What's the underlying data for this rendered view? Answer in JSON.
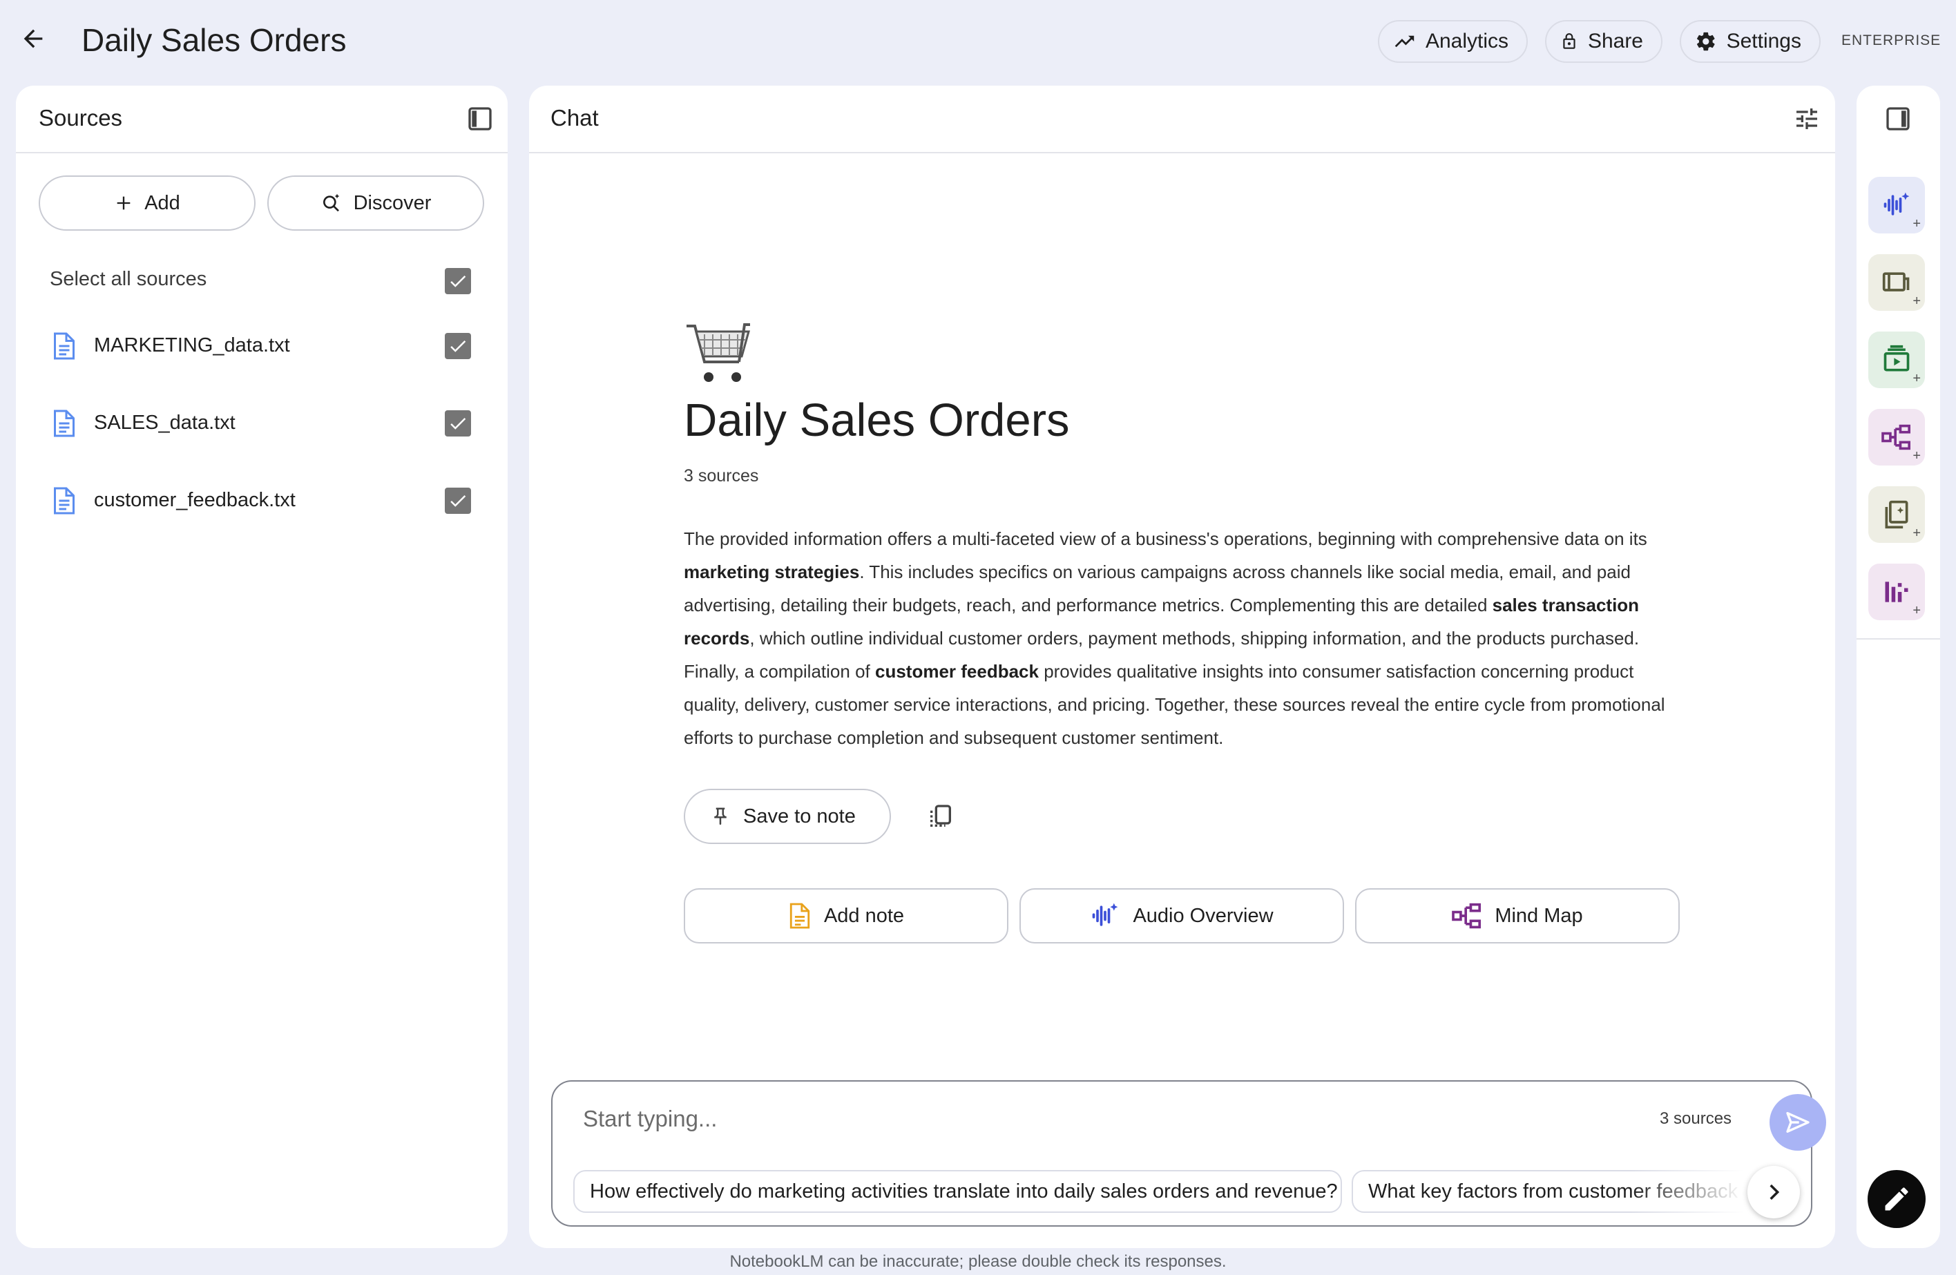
{
  "header": {
    "back_icon": "arrow-left-icon",
    "notebook_title": "Daily Sales Orders",
    "analytics_label": "Analytics",
    "share_label": "Share",
    "settings_label": "Settings",
    "badge": "ENTERPRISE"
  },
  "sources": {
    "title": "Sources",
    "add_label": "Add",
    "discover_label": "Discover",
    "select_all_label": "Select all sources",
    "items": [
      {
        "name": "MARKETING_data.txt",
        "checked": true
      },
      {
        "name": "SALES_data.txt",
        "checked": true
      },
      {
        "name": "customer_feedback.txt",
        "checked": true
      }
    ]
  },
  "chat": {
    "title": "Chat",
    "notebook_emoji": "shopping-cart",
    "notebook_title": "Daily Sales Orders",
    "source_count": "3 sources",
    "summary": {
      "p1": "The provided information offers a multi-faceted view of a business's operations, beginning with comprehensive data on its ",
      "b1": "marketing strategies",
      "p2": ". This includes specifics on various campaigns across channels like social media, email, and paid advertising, detailing their budgets, reach, and performance metrics. Complementing this are detailed ",
      "b2": "sales transaction records",
      "p3": ", which outline individual customer orders, payment methods, shipping information, and the products purchased. Finally, a compilation of ",
      "b3": "customer feedback",
      "p4": " provides qualitative insights into consumer satisfaction concerning product quality, delivery, customer service interactions, and pricing. Together, these sources reveal the entire cycle from promotional efforts to purchase completion and subsequent customer sentiment."
    },
    "save_to_note_label": "Save to note",
    "actions": {
      "add_note": "Add note",
      "audio_overview": "Audio Overview",
      "mind_map": "Mind Map"
    },
    "composer": {
      "placeholder": "Start typing...",
      "source_count": "3 sources"
    },
    "suggestions": [
      "How effectively do marketing activities translate into daily sales orders and revenue?",
      "What key factors from customer feedback contribute to satisfaction?"
    ]
  },
  "studio": {
    "tiles": [
      "audio-overview-icon",
      "video-overview-icon",
      "slides-icon",
      "mind-map-icon",
      "reports-icon",
      "flashcards-icon"
    ]
  },
  "footer": {
    "disclaimer": "NotebookLM can be inaccurate; please double check its responses."
  },
  "colors": {
    "background": "#eceef8",
    "panel": "#ffffff",
    "accent": "#a9b4f5",
    "audio_blue": "#3b4fd8",
    "mind_purple": "#7b2d8b",
    "note_yellow": "#e9a21b"
  }
}
